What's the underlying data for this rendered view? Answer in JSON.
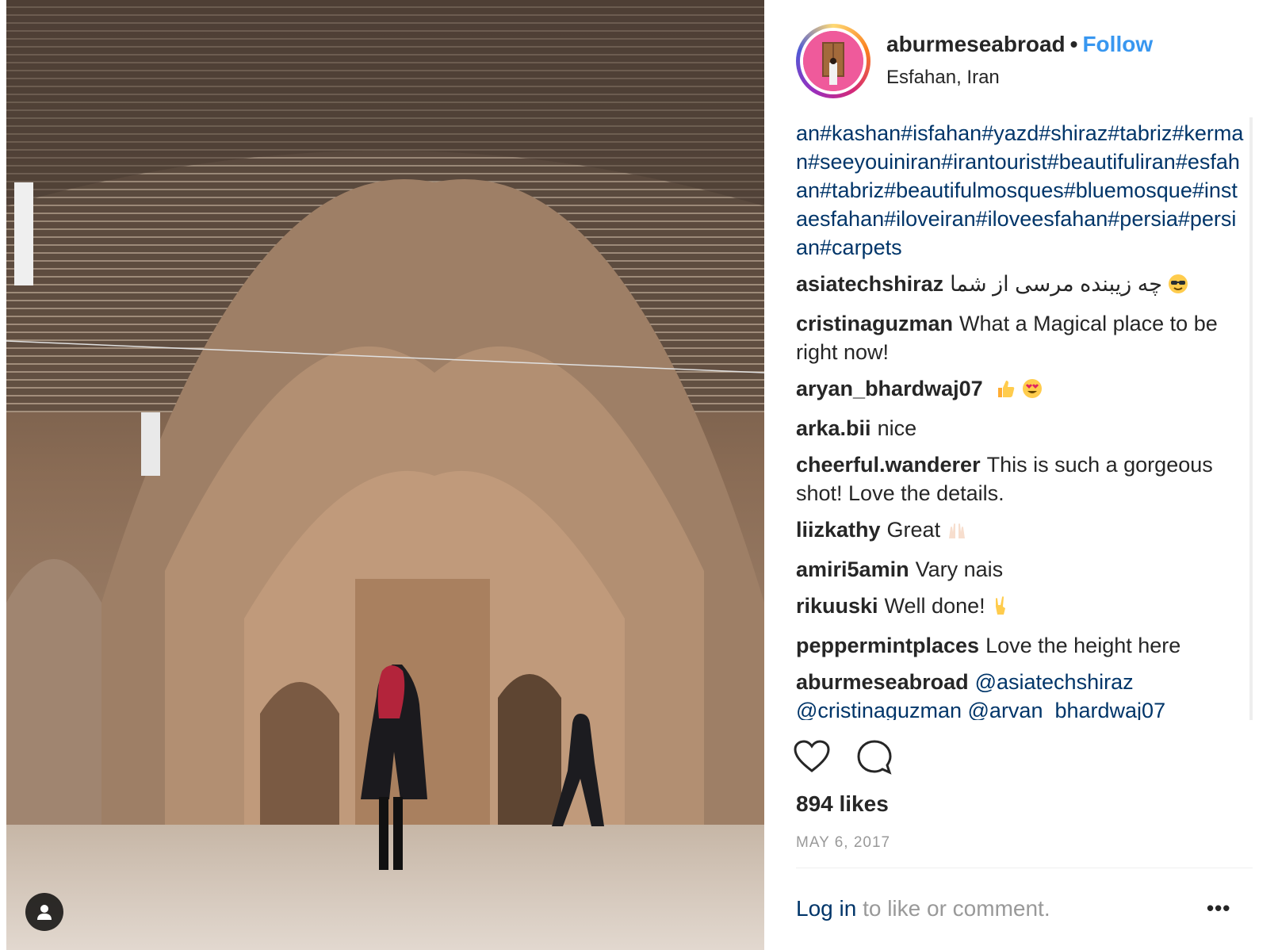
{
  "post": {
    "username": "aburmeseabroad",
    "separator": "•",
    "follow_label": "Follow",
    "location": "Esfahan, Iran",
    "caption_hashtags": "an#kashan#isfahan#yazd#shiraz#tabriz#kerman#seeyouiniran#irantourist#beautifuliran#esfahan#tabriz#beautifulmosques#bluemosque#instaesfahan#iloveiran#iloveesfahan#persia#persian#carpets",
    "comments": [
      {
        "user": "asiatechshiraz",
        "text": "چه زیبنده مرسی از شما",
        "emoji": "sunglasses-emoji"
      },
      {
        "user": "cristinaguzman",
        "text": "What a Magical place to be right now!"
      },
      {
        "user": "aryan_bhardwaj07",
        "text": "",
        "emoji": "thumbs-up-emoji heart-eyes-emoji"
      },
      {
        "user": "arka.bii",
        "text": "nice"
      },
      {
        "user": "cheerful.wanderer",
        "text": "This is such a gorgeous shot! Love the details."
      },
      {
        "user": "liizkathy",
        "text": "Great",
        "emoji": "raised-hands-emoji"
      },
      {
        "user": "amiri5amin",
        "text": "Vary nais"
      },
      {
        "user": "rikuuski",
        "text": "Well done!",
        "emoji": "rock-on-emoji"
      },
      {
        "user": "peppermintplaces",
        "text": "Love the height here"
      },
      {
        "user": "aburmeseabroad",
        "mention1": "@asiatechshiraz",
        "mention2": "@cristinaguzman",
        "mention3": "@arvan_bhardwaj07"
      }
    ],
    "likes": "894 likes",
    "date": "MAY 6, 2017",
    "login_link": "Log in",
    "login_text": " to like or comment.",
    "more_label": "•••"
  },
  "icons": [
    "heart-icon",
    "comment-icon",
    "user-tag-icon",
    "more-options-icon"
  ],
  "colors": {
    "link": "#003569",
    "follow": "#3897f0",
    "muted": "#999999",
    "text": "#262626"
  }
}
